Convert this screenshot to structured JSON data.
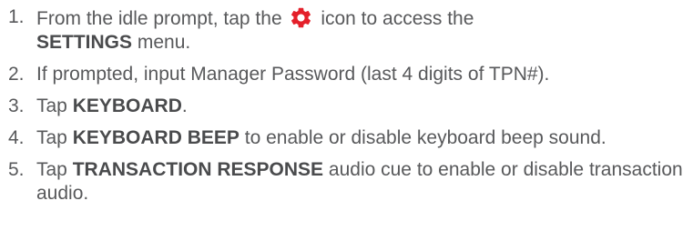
{
  "steps": [
    {
      "number": "1.",
      "before": "From the idle prompt, tap the",
      "icon": "gear-icon",
      "after": "icon to access the",
      "bold": "SETTINGS",
      "tail": "menu."
    },
    {
      "number": "2.",
      "text": "If prompted, input Manager Password (last 4 digits of TPN#)."
    },
    {
      "number": "3.",
      "prefix": "Tap",
      "bold": "KEYBOARD",
      "suffix": "."
    },
    {
      "number": "4.",
      "prefix": "Tap",
      "bold": "KEYBOARD BEEP",
      "suffix": "to enable or disable keyboard beep sound."
    },
    {
      "number": "5.",
      "prefix": "Tap",
      "bold": "TRANSACTION RESPONSE",
      "suffix": "audio cue to enable or disable transaction audio."
    }
  ],
  "colors": {
    "text": "#58595b",
    "icon": "#e4202a"
  }
}
